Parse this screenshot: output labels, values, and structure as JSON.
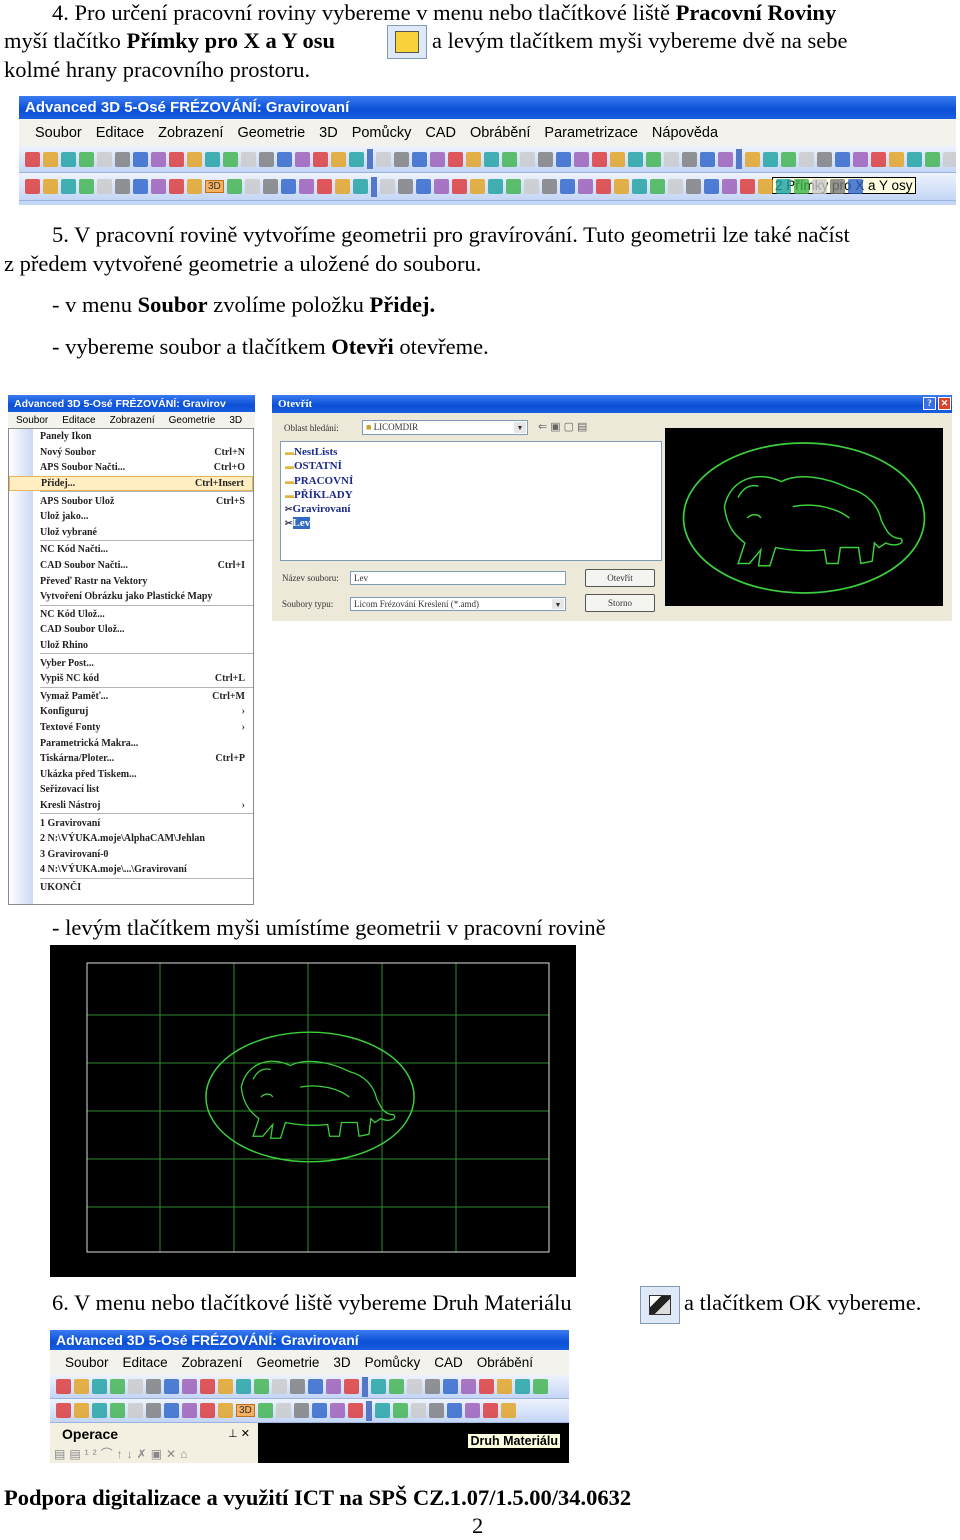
{
  "step4": {
    "line1_a": "4. Pro určení pracovní roviny vybereme v menu nebo tlačítkové liště ",
    "line1_b": "Pracovní Roviny",
    "line2_a": "myší tlačítko ",
    "line2_b": "Přímky pro X a Y osu",
    "line2_c": " a levým tlačítkem myši vybereme dvě na sebe",
    "line3": "kolmé hrany pracovního prostoru.",
    "icon": "primky-xy-icon"
  },
  "app": {
    "title": "Advanced 3D 5-Osé FRÉZOVÁNÍ: Gravirovaní",
    "menu": [
      "Soubor",
      "Editace",
      "Zobrazení",
      "Geometrie",
      "3D",
      "Pomůcky",
      "CAD",
      "Obrábění",
      "Parametrizace",
      "Nápověda"
    ],
    "tooltip1": "2 Přímky pro X a Y osy",
    "btn3d": "3D"
  },
  "step5": {
    "line1": "5. V pracovní rovině vytvoříme geometrii pro gravírování. Tuto geometrii lze také načíst",
    "line2": "z předem vytvořené geometrie a uložené do souboru.",
    "line3_a": "- v menu ",
    "line3_b": "Soubor",
    "line3_c": " zvolíme položku ",
    "line3_d": "Přidej.",
    "line4_a": "- vybereme soubor a tlačítkem ",
    "line4_b": "Otevři",
    "line4_c": " otevřeme."
  },
  "menu_shot": {
    "title": "Advanced 3D 5-Osé FRÉZOVÁNÍ: Gravirov",
    "menubar": [
      "Soubor",
      "Editace",
      "Zobrazení",
      "Geometrie",
      "3D"
    ],
    "items": [
      {
        "label": "Panely Ikon",
        "shortcut": ""
      },
      {
        "label": "Nový Soubor",
        "shortcut": "Ctrl+N"
      },
      {
        "label": "APS Soubor Načti...",
        "shortcut": "Ctrl+O"
      },
      {
        "label": "Přidej...",
        "shortcut": "Ctrl+Insert",
        "highlighted": true,
        "sep_after": true
      },
      {
        "label": "APS Soubor Ulož",
        "shortcut": "Ctrl+S"
      },
      {
        "label": "Ulož jako...",
        "shortcut": ""
      },
      {
        "label": "Ulož vybrané",
        "shortcut": "",
        "sep_after": true
      },
      {
        "label": "NC Kód Načti...",
        "shortcut": ""
      },
      {
        "label": "CAD Soubor Načti...",
        "shortcut": "Ctrl+I"
      },
      {
        "label": "Převeď Rastr na Vektory",
        "shortcut": ""
      },
      {
        "label": "Vytvoření Obrázku jako Plastické Mapy",
        "shortcut": "",
        "sep_after": true
      },
      {
        "label": "NC Kód Ulož...",
        "shortcut": ""
      },
      {
        "label": "CAD Soubor Ulož...",
        "shortcut": ""
      },
      {
        "label": "Ulož Rhino",
        "shortcut": "",
        "sep_after": true
      },
      {
        "label": "Vyber Post...",
        "shortcut": ""
      },
      {
        "label": "Vypiš NC kód",
        "shortcut": "Ctrl+L",
        "sep_after": true
      },
      {
        "label": "Vymaž Paměť...",
        "shortcut": "Ctrl+M"
      },
      {
        "label": "Konfiguruj",
        "shortcut": "›"
      },
      {
        "label": "Textové Fonty",
        "shortcut": "›"
      },
      {
        "label": "Parametrická Makra...",
        "shortcut": ""
      },
      {
        "label": "Tiskárna/Ploter...",
        "shortcut": "Ctrl+P"
      },
      {
        "label": "Ukázka před Tiskem...",
        "shortcut": ""
      },
      {
        "label": "Seřizovací list",
        "shortcut": ""
      },
      {
        "label": "Kresli Nástroj",
        "shortcut": "›",
        "sep_after": true
      },
      {
        "label": "1 Gravirovaní",
        "shortcut": ""
      },
      {
        "label": "2 N:\\VÝUKA.moje\\AlphaCAM\\Jehlan",
        "shortcut": ""
      },
      {
        "label": "3 Gravirovaní-0",
        "shortcut": ""
      },
      {
        "label": "4 N:\\VÝUKA.moje\\...\\Gravirovaní",
        "shortcut": "",
        "sep_after": true
      },
      {
        "label": "UKONČI",
        "shortcut": ""
      }
    ]
  },
  "dialog": {
    "title": "Otevřít",
    "look_in_label": "Oblast hledání:",
    "look_in_value": "LICOMDIR",
    "files": [
      "NestLists",
      "OSTATNÍ",
      "PRACOVNÍ",
      "PŘÍKLADY",
      "Gravirovaní",
      "Lev"
    ],
    "selected": "Lev",
    "filename_label": "Název souboru:",
    "filename_value": "Lev",
    "type_label": "Soubory typu:",
    "type_value": "Licom Frézování Kreslení (*.amd)",
    "open": "Otevřít",
    "cancel": "Storno"
  },
  "step_place": "- levým tlačítkem myši umístíme geometrii v pracovní rovině",
  "step6": {
    "text_a": "6. V menu nebo tlačítkové liště vybereme Druh Materiálu",
    "text_b": "a tlačítkem OK vybereme.",
    "icon": "druh-materialu-icon"
  },
  "shot3": {
    "title": "Advanced 3D 5-Osé FRÉZOVÁNÍ: Gravirovaní",
    "menu": [
      "Soubor",
      "Editace",
      "Zobrazení",
      "Geometrie",
      "3D",
      "Pomůcky",
      "CAD",
      "Obrábění"
    ],
    "panel": "Operace",
    "tooltip": "Druh Materiálu",
    "btn3d": "3D"
  },
  "footer": {
    "text": "Podpora digitalizace a využití ICT na SPŠ  CZ.1.07/1.5.00/34.0632",
    "page": "2"
  },
  "colors": {
    "titlebar": "#0a4fd6",
    "viewport": "#000000",
    "geometry": "#3ccf3c"
  }
}
